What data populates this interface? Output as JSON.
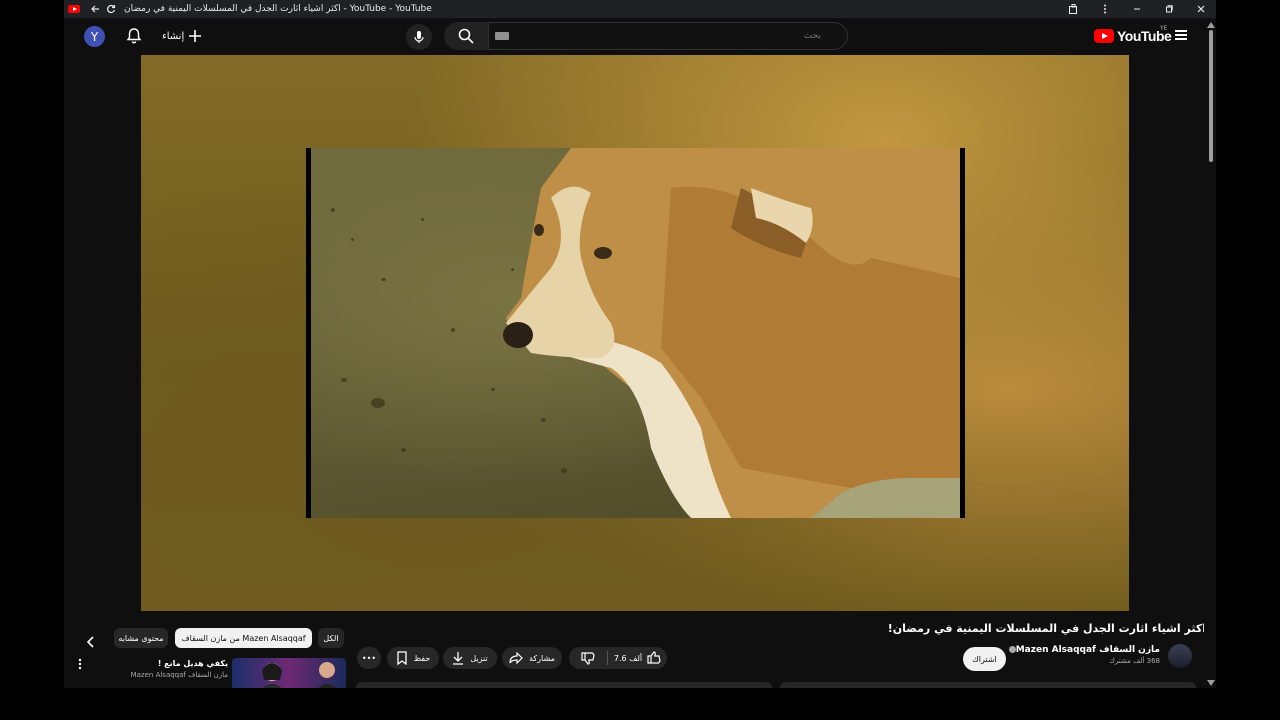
{
  "browser": {
    "tab_title": "اكثر اشياء اثارت الجدل في المسلسلات اليمنية في رمضان - YouTube - YouTube"
  },
  "masthead": {
    "avatar_letter": "Y",
    "create_label": "إنشاء",
    "search_placeholder": "بحث",
    "logo_text": "YouTube",
    "logo_region": "YE"
  },
  "chips": {
    "all": "الكل",
    "from_channel": "من مازن السقاف Mazen Alsaqqaf",
    "related": "محتوى مشابه"
  },
  "video": {
    "title": "اكثر اشياء اثارت الجدل في المسلسلات اليمنية في رمضان!",
    "channel_name": "مازن السقاف Mazen Alsaqqaf",
    "subscribers": "368 ألف مشترك",
    "subscribe_label": "اشتراك",
    "likes": "7.6 ألف",
    "share_label": "مشاركة",
    "download_label": "تنزيل",
    "save_label": "حفظ",
    "more_label": "•••"
  },
  "recommendation": {
    "title": "يكفي هديل مانع !",
    "channel": "مازن السقاف Mazen Alsaqqaf"
  },
  "colors": {
    "brand_red": "#ff0000",
    "background": "#0f0f0f",
    "chip": "#272727"
  }
}
